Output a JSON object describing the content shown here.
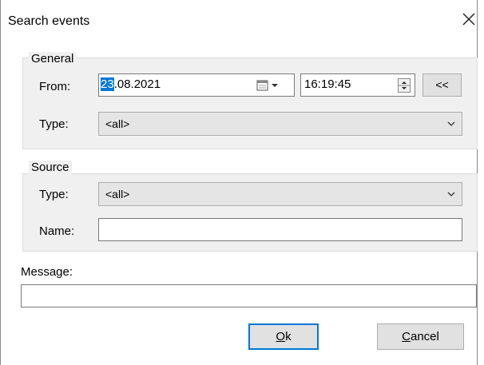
{
  "window": {
    "title": "Search events"
  },
  "general": {
    "legend": "General",
    "from_label": "From:",
    "date_day": "23",
    "date_rest": ".08.2021",
    "time": "16:19:45",
    "back_button": "<<",
    "type_label": "Type:",
    "type_value": "<all>"
  },
  "source": {
    "legend": "Source",
    "type_label": "Type:",
    "type_value": "<all>",
    "name_label": "Name:",
    "name_value": ""
  },
  "message": {
    "label": "Message:",
    "value": ""
  },
  "buttons": {
    "ok_mnemonic": "O",
    "ok_rest": "k",
    "cancel_mnemonic": "C",
    "cancel_rest": "ancel"
  },
  "colors": {
    "accent": "#0078d7",
    "group_bg": "#f0f0f0",
    "combo_bg": "#e5e5e5"
  }
}
